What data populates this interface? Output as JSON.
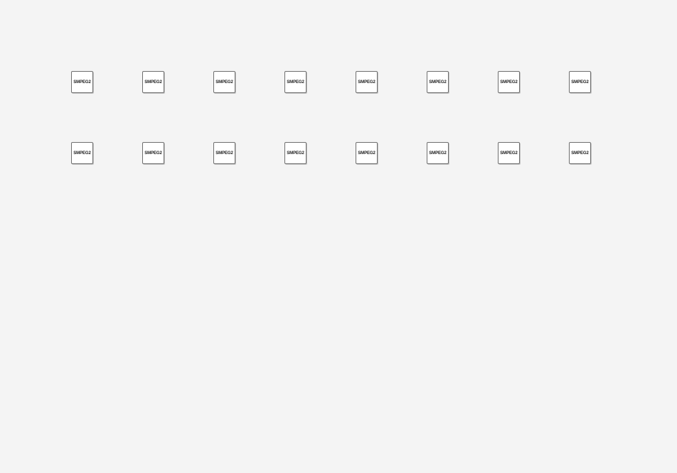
{
  "canvas": {
    "background": "#f4f4f4",
    "block_rows": [
      {
        "blocks": [
          {
            "label": "SMPEG2"
          },
          {
            "label": "SMPEG2"
          },
          {
            "label": "SMPEG2"
          },
          {
            "label": "SMPEG2"
          },
          {
            "label": "SMPEG2"
          },
          {
            "label": "SMPEG2"
          },
          {
            "label": "SMPEG2"
          },
          {
            "label": "SMPEG2"
          }
        ]
      },
      {
        "blocks": [
          {
            "label": "SMPEG2"
          },
          {
            "label": "SMPEG2"
          },
          {
            "label": "SMPEG2"
          },
          {
            "label": "SMPEG2"
          },
          {
            "label": "SMPEG2"
          },
          {
            "label": "SMPEG2"
          },
          {
            "label": "SMPEG2"
          },
          {
            "label": "SMPEG2"
          }
        ]
      }
    ]
  }
}
